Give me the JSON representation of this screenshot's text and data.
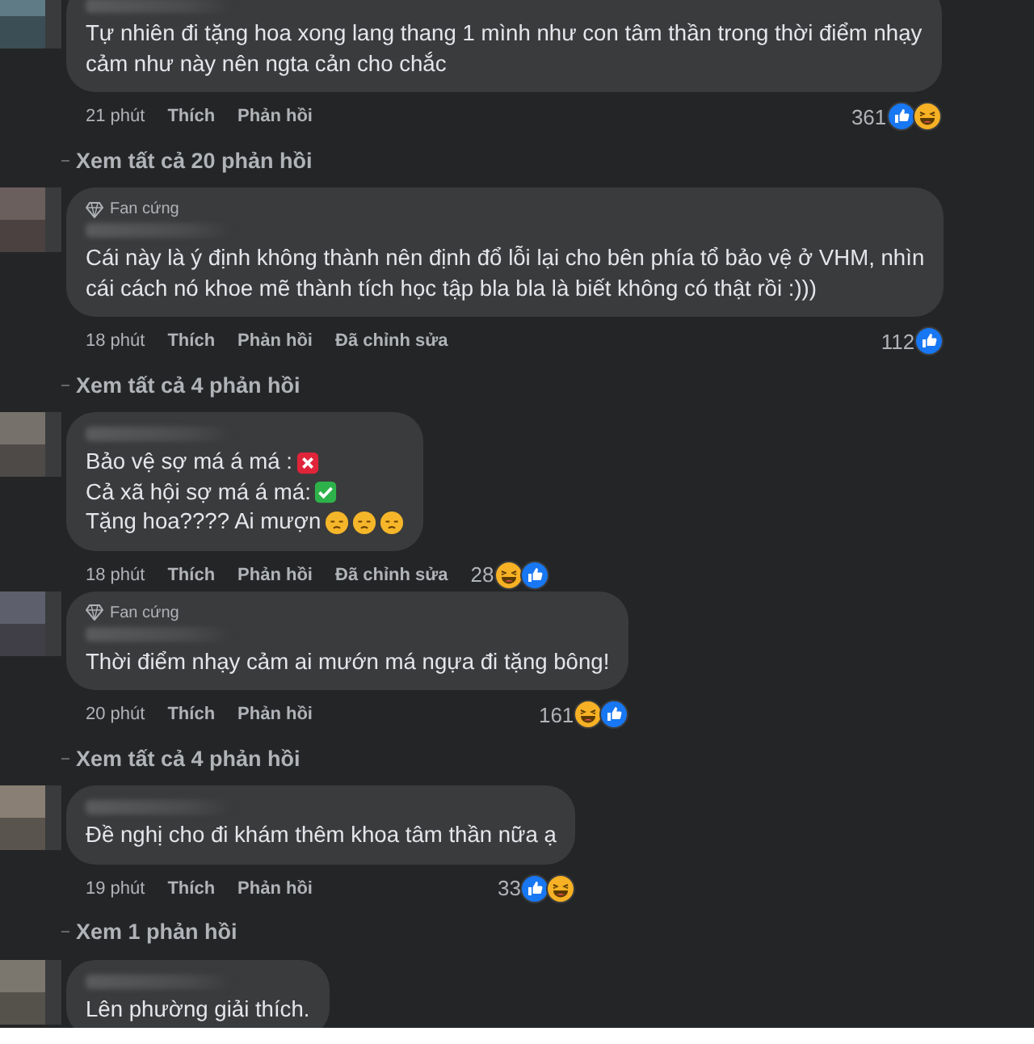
{
  "items": [
    {
      "kind": "comment",
      "lines": [
        {
          "text": "Tự nhiên đi tặng hoa xong lang thang 1 mình như con tâm thần trong thời điểm nhạy"
        },
        {
          "text": "cảm như này nên ngta cản cho chắc"
        }
      ],
      "time": "21 phút",
      "like": "Thích",
      "reply": "Phản hồi",
      "count": "361",
      "reactions": [
        {
          "kind": "like"
        },
        {
          "kind": "haha"
        }
      ]
    },
    {
      "kind": "replies",
      "text": "Xem tất cả 20 phản hồi"
    },
    {
      "kind": "comment",
      "badge": "Fan cứng",
      "lines": [
        {
          "text": "Cái này là ý định không thành nên định đổ lỗi lại cho bên phía tổ bảo vệ ở VHM, nhìn"
        },
        {
          "text": "cái cách nó khoe mẽ thành tích học tập bla bla là biết không có thật rồi :)))"
        }
      ],
      "time": "18 phút",
      "like": "Thích",
      "reply": "Phản hồi",
      "edited": "Đã chỉnh sửa",
      "count": "112",
      "reactions": [
        {
          "kind": "like"
        }
      ]
    },
    {
      "kind": "replies",
      "text": "Xem tất cả 4 phản hồi"
    },
    {
      "kind": "comment",
      "lines": [
        {
          "text": "Bảo vệ sợ má á má :",
          "icons": [
            {
              "kind": "cross"
            }
          ]
        },
        {
          "text": "Cả xã hội sợ má á má:",
          "icons": [
            {
              "kind": "check"
            }
          ]
        },
        {
          "text": "Tặng hoa???? Ai mượn",
          "icons": [
            {
              "kind": "sad"
            },
            {
              "kind": "sad"
            },
            {
              "kind": "sad"
            }
          ]
        }
      ],
      "time": "18 phút",
      "like": "Thích",
      "reply": "Phản hồi",
      "edited": "Đã chỉnh sửa",
      "count": "28",
      "reactions": [
        {
          "kind": "haha"
        },
        {
          "kind": "like"
        }
      ]
    },
    {
      "kind": "comment",
      "badge": "Fan cứng",
      "lines": [
        {
          "text": "Thời điểm nhạy cảm ai mướn má ngựa đi tặng bông!"
        }
      ],
      "time": "20 phút",
      "like": "Thích",
      "reply": "Phản hồi",
      "count": "161",
      "reactions": [
        {
          "kind": "haha"
        },
        {
          "kind": "like"
        }
      ]
    },
    {
      "kind": "replies",
      "text": "Xem tất cả 4 phản hồi"
    },
    {
      "kind": "comment",
      "lines": [
        {
          "text": "Đề nghị cho đi khám thêm khoa tâm thần nữa ạ"
        }
      ],
      "time": "19 phút",
      "like": "Thích",
      "reply": "Phản hồi",
      "count": "33",
      "reactions": [
        {
          "kind": "like"
        },
        {
          "kind": "haha"
        }
      ]
    },
    {
      "kind": "replies",
      "text": "Xem 1 phản hồi"
    },
    {
      "kind": "comment",
      "lines": [
        {
          "text": "Lên phường giải thích."
        }
      ]
    }
  ]
}
